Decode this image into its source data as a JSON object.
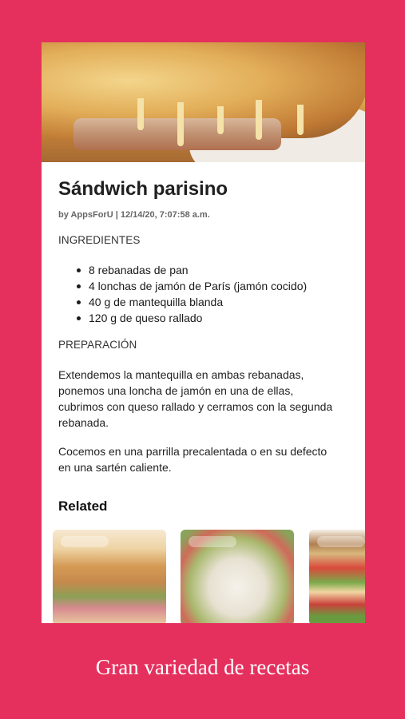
{
  "recipe": {
    "title": "Sándwich parisino",
    "meta": "by AppsForU | 12/14/20, 7:07:58 a.m.",
    "ingredients_label": "INGREDIENTES",
    "ingredients": [
      "8 rebanadas de pan",
      "4 lonchas de jamón de París (jamón cocido)",
      "40 g de mantequilla blanda",
      "120 g de queso rallado"
    ],
    "preparation_label": "PREPARACIÓN",
    "steps": [
      "Extendemos la mantequilla en ambas rebanadas, ponemos una loncha de jamón en una de ellas, cubrimos con queso rallado y cerramos con la segunda rebanada.",
      "Cocemos en una parrilla precalentada o en su defecto en una sartén caliente."
    ]
  },
  "related": {
    "label": "Related",
    "items": [
      {
        "image": "toasted-club-sandwich"
      },
      {
        "image": "chicken-wrap"
      },
      {
        "image": "stacked-club-sandwich"
      }
    ]
  },
  "tagline": "Gran variedad de recetas",
  "colors": {
    "background": "#e5305e",
    "card": "#ffffff"
  }
}
